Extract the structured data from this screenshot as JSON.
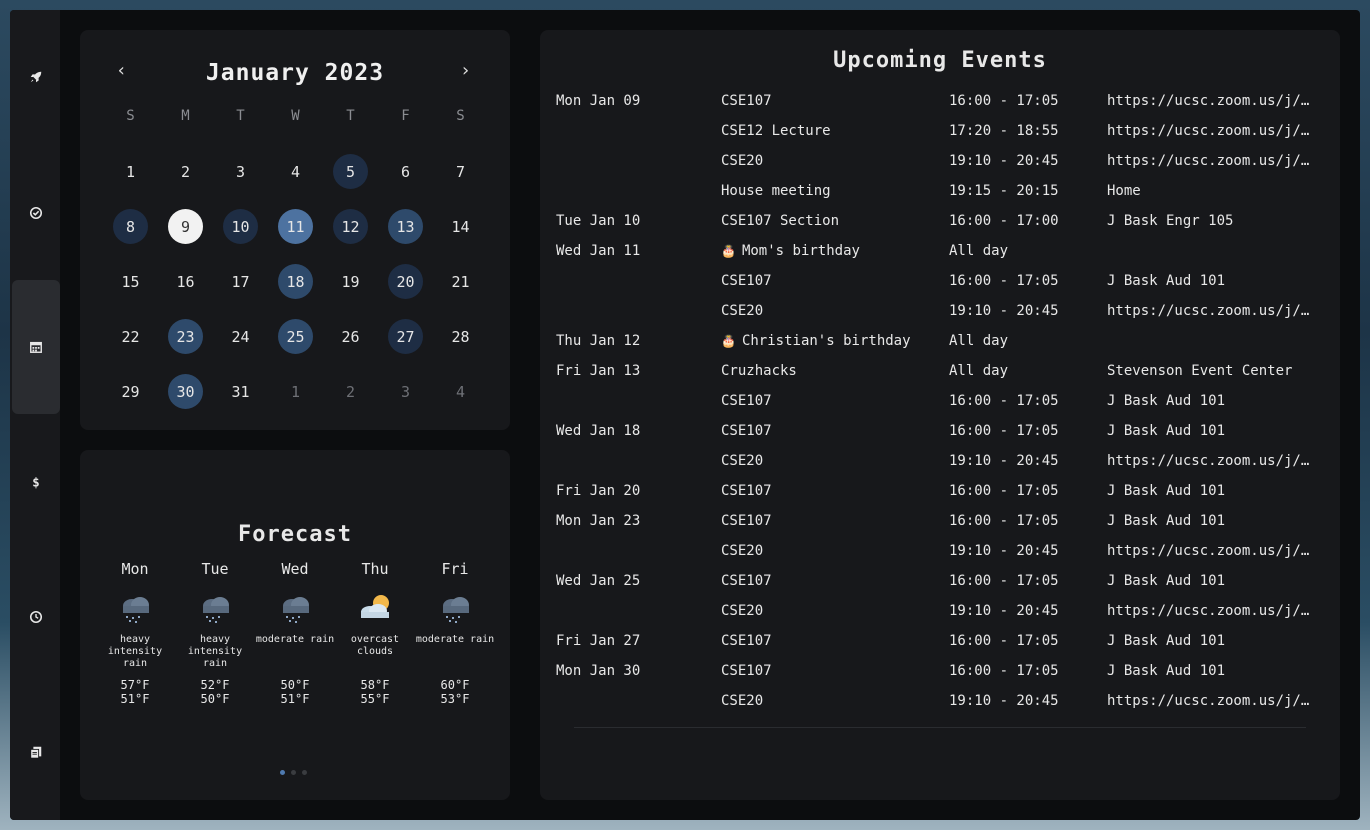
{
  "calendar": {
    "title": "January 2023",
    "prev_label": "‹",
    "next_label": "›",
    "weekdays": [
      "S",
      "M",
      "T",
      "W",
      "T",
      "F",
      "S"
    ],
    "days": [
      {
        "n": "1"
      },
      {
        "n": "2"
      },
      {
        "n": "3"
      },
      {
        "n": "4"
      },
      {
        "n": "5",
        "h": 1
      },
      {
        "n": "6"
      },
      {
        "n": "7"
      },
      {
        "n": "8",
        "h": 1
      },
      {
        "n": "9",
        "today": true
      },
      {
        "n": "10",
        "h": 1
      },
      {
        "n": "11",
        "h": 3
      },
      {
        "n": "12",
        "h": 1
      },
      {
        "n": "13",
        "h": 2
      },
      {
        "n": "14"
      },
      {
        "n": "15"
      },
      {
        "n": "16"
      },
      {
        "n": "17"
      },
      {
        "n": "18",
        "h": 2
      },
      {
        "n": "19"
      },
      {
        "n": "20",
        "h": 1
      },
      {
        "n": "21"
      },
      {
        "n": "22"
      },
      {
        "n": "23",
        "h": 2
      },
      {
        "n": "24"
      },
      {
        "n": "25",
        "h": 2
      },
      {
        "n": "26"
      },
      {
        "n": "27",
        "h": 1
      },
      {
        "n": "28"
      },
      {
        "n": "29"
      },
      {
        "n": "30",
        "h": 2
      },
      {
        "n": "31"
      },
      {
        "n": "1",
        "muted": true
      },
      {
        "n": "2",
        "muted": true
      },
      {
        "n": "3",
        "muted": true
      },
      {
        "n": "4",
        "muted": true
      }
    ]
  },
  "forecast": {
    "title": "Forecast",
    "days": [
      {
        "day": "Mon",
        "icon": "rain-cloud-icon",
        "desc": "heavy intensity rain",
        "high": "57°F",
        "low": "51°F"
      },
      {
        "day": "Tue",
        "icon": "rain-cloud-icon",
        "desc": "heavy intensity rain",
        "high": "52°F",
        "low": "50°F"
      },
      {
        "day": "Wed",
        "icon": "rain-cloud-icon",
        "desc": "moderate rain",
        "high": "50°F",
        "low": "51°F"
      },
      {
        "day": "Thu",
        "icon": "sun-cloud-icon",
        "desc": "overcast clouds",
        "high": "58°F",
        "low": "55°F"
      },
      {
        "day": "Fri",
        "icon": "rain-cloud-icon",
        "desc": "moderate rain",
        "high": "60°F",
        "low": "53°F"
      }
    ],
    "page_dots": 3,
    "active_dot": 0
  },
  "events": {
    "title": "Upcoming Events",
    "rows": [
      {
        "date": "Mon Jan 09",
        "name": "CSE107",
        "time": "16:00 - 17:05",
        "loc": "https://ucsc.zoom.us/j/…"
      },
      {
        "date": "",
        "name": "CSE12 Lecture",
        "time": "17:20 - 18:55",
        "loc": "https://ucsc.zoom.us/j/…"
      },
      {
        "date": "",
        "name": "CSE20",
        "time": "19:10 - 20:45",
        "loc": "https://ucsc.zoom.us/j/…"
      },
      {
        "date": "",
        "name": "House meeting",
        "time": "19:15 - 20:15",
        "loc": "Home"
      },
      {
        "date": "Tue Jan 10",
        "name": "CSE107 Section",
        "time": "16:00 - 17:00",
        "loc": "J Bask Engr 105"
      },
      {
        "date": "Wed Jan 11",
        "name": "Mom's birthday",
        "birthday": true,
        "time": "All day",
        "loc": ""
      },
      {
        "date": "",
        "name": "CSE107",
        "time": "16:00 - 17:05",
        "loc": "J Bask Aud 101"
      },
      {
        "date": "",
        "name": "CSE20",
        "time": "19:10 - 20:45",
        "loc": "https://ucsc.zoom.us/j/…"
      },
      {
        "date": "Thu Jan 12",
        "name": "Christian's birthday",
        "birthday": true,
        "time": "All day",
        "loc": ""
      },
      {
        "date": "Fri Jan 13",
        "name": "Cruzhacks",
        "time": "All day",
        "loc": "Stevenson Event Center"
      },
      {
        "date": "",
        "name": "CSE107",
        "time": "16:00 - 17:05",
        "loc": "J Bask Aud 101"
      },
      {
        "date": "Wed Jan 18",
        "name": "CSE107",
        "time": "16:00 - 17:05",
        "loc": "J Bask Aud 101"
      },
      {
        "date": "",
        "name": "CSE20",
        "time": "19:10 - 20:45",
        "loc": "https://ucsc.zoom.us/j/…"
      },
      {
        "date": "Fri Jan 20",
        "name": "CSE107",
        "time": "16:00 - 17:05",
        "loc": "J Bask Aud 101"
      },
      {
        "date": "Mon Jan 23",
        "name": "CSE107",
        "time": "16:00 - 17:05",
        "loc": "J Bask Aud 101"
      },
      {
        "date": "",
        "name": "CSE20",
        "time": "19:10 - 20:45",
        "loc": "https://ucsc.zoom.us/j/…"
      },
      {
        "date": "Wed Jan 25",
        "name": "CSE107",
        "time": "16:00 - 17:05",
        "loc": "J Bask Aud 101"
      },
      {
        "date": "",
        "name": "CSE20",
        "time": "19:10 - 20:45",
        "loc": "https://ucsc.zoom.us/j/…"
      },
      {
        "date": "Fri Jan 27",
        "name": "CSE107",
        "time": "16:00 - 17:05",
        "loc": "J Bask Aud 101"
      },
      {
        "date": "Mon Jan 30",
        "name": "CSE107",
        "time": "16:00 - 17:05",
        "loc": "J Bask Aud 101"
      },
      {
        "date": "",
        "name": "CSE20",
        "time": "19:10 - 20:45",
        "loc": "https://ucsc.zoom.us/j/…"
      }
    ]
  },
  "sidebar": {
    "items": [
      {
        "icon": "rocket-icon"
      },
      {
        "icon": "check-circle-icon"
      },
      {
        "icon": "calendar-icon",
        "active": true
      },
      {
        "icon": "dollar-icon"
      },
      {
        "icon": "clock-icon"
      },
      {
        "icon": "notebook-icon"
      }
    ]
  },
  "colors": {
    "panel": "#17181b",
    "highlight_dark": "#1e2d44",
    "highlight_mid": "#2e4a6b",
    "highlight_light": "#4d72a0"
  }
}
